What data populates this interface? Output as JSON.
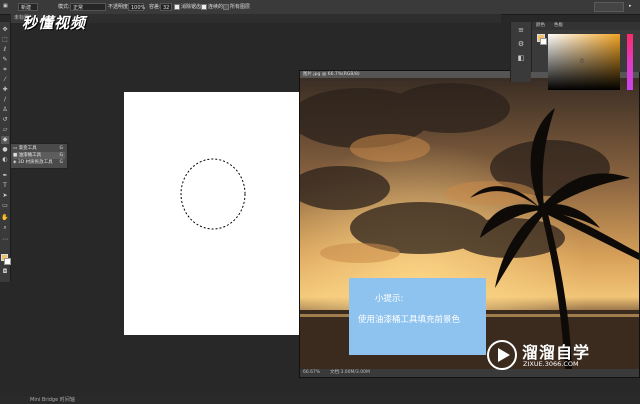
{
  "options_bar": {
    "mode_value": "新建",
    "mode_label": "模式:",
    "mode_select": "正常",
    "opacity_label": "不透明度:",
    "opacity_value": "100%",
    "tolerance_label": "容差:",
    "tolerance_value": "32",
    "antialias_label": "消除锯齿",
    "contiguous_label": "连续的",
    "all_layers_label": "所有图层"
  },
  "doc_tab": {
    "label": "未标题"
  },
  "logo": {
    "text": "秒懂视频"
  },
  "flyout": {
    "items": [
      {
        "label": "渐变工具",
        "shortcut": "G"
      },
      {
        "label": "油漆桶工具",
        "shortcut": "G"
      },
      {
        "label": "3D 材质拖放工具",
        "shortcut": "G"
      }
    ]
  },
  "image_window": {
    "title": "图片.jpg @ 66.7%(RGB/8)",
    "status_zoom": "66.67%",
    "status_doc": "文档:3.00M/3.00M"
  },
  "tip": {
    "title": "小提示:",
    "text": "使用油漆桶工具填充前景色"
  },
  "watermark": {
    "title": "溜溜自学",
    "url": "ZIXUE.3066.COM"
  },
  "color_panel": {
    "tab_color": "颜色",
    "tab_swatches": "色板",
    "readout": "0",
    "foreground_color": "#f5c36a",
    "background_color": "#ffffff"
  },
  "bottom_bar": {
    "text": "Mini Bridge  时间轴"
  },
  "colors": {
    "tip_bg": "#8ec3ef",
    "canvas": "#ffffff",
    "app_bg": "#282828"
  }
}
